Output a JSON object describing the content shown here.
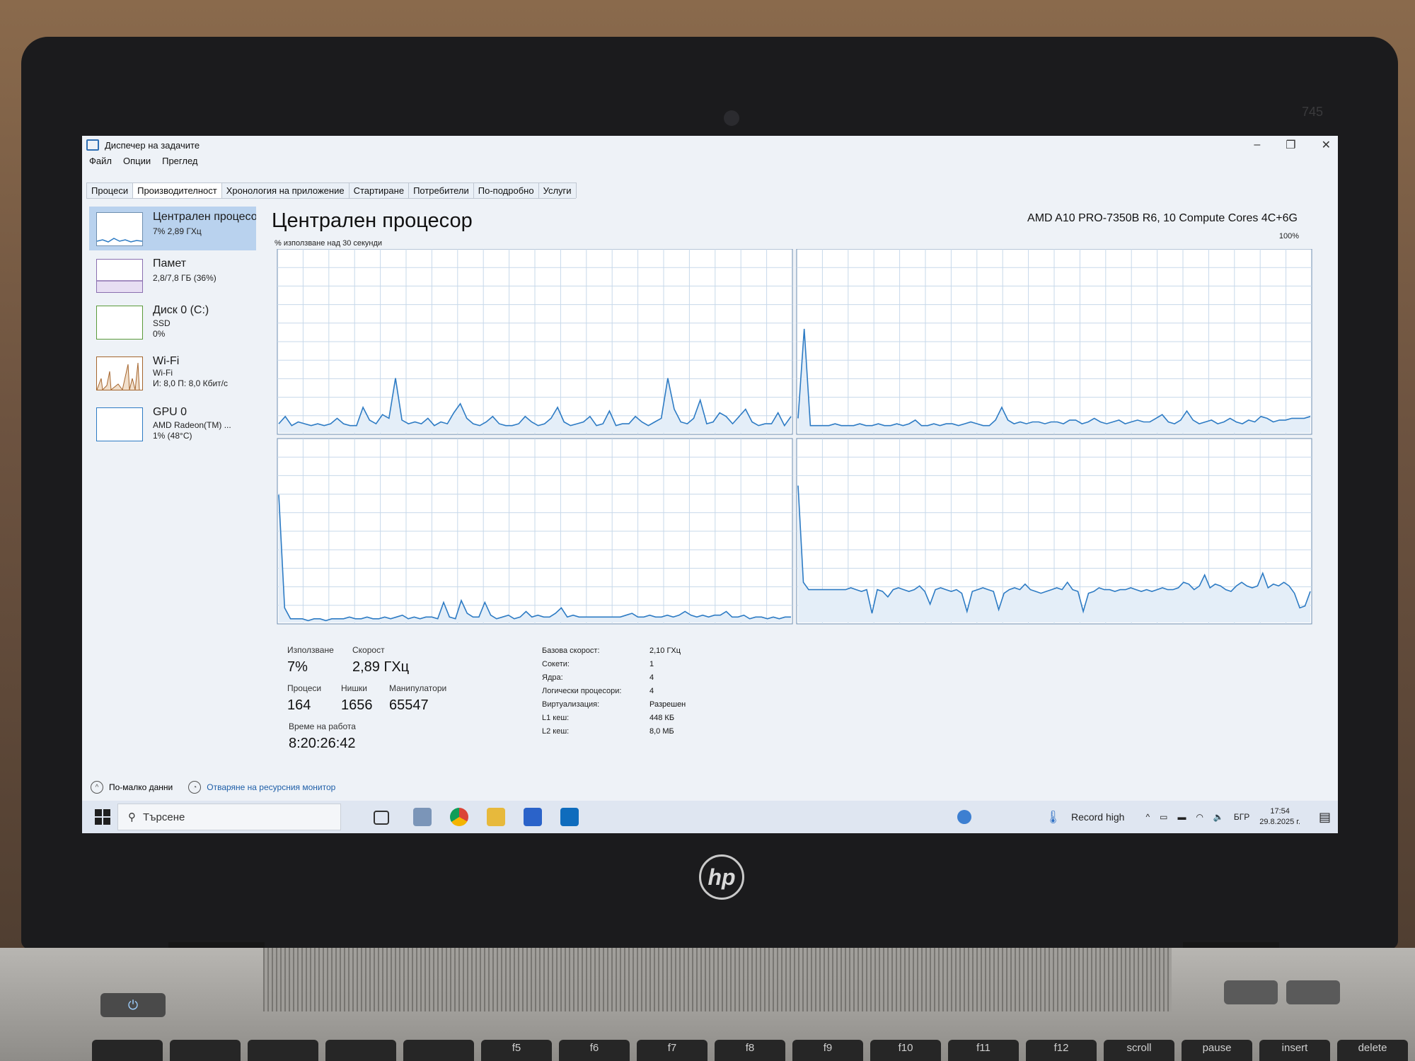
{
  "window": {
    "title": "Диспечер на задачите",
    "controls": [
      "–",
      "❐",
      "✕"
    ]
  },
  "menu": [
    "Файл",
    "Опции",
    "Преглед"
  ],
  "tabs": [
    {
      "label": "Процеси",
      "active": false
    },
    {
      "label": "Производителност",
      "active": true
    },
    {
      "label": "Хронология на приложение",
      "active": false
    },
    {
      "label": "Стартиране",
      "active": false
    },
    {
      "label": "Потребители",
      "active": false
    },
    {
      "label": "По-подробно",
      "active": false
    },
    {
      "label": "Услуги",
      "active": false
    }
  ],
  "sidebar": {
    "items": [
      {
        "name": "Централен процесор",
        "sub1": "7% 2,89 ГХц",
        "sub2": "",
        "sub3": ""
      },
      {
        "name": "Памет",
        "sub1": "2,8/7,8 ГБ (36%)",
        "sub2": "",
        "sub3": ""
      },
      {
        "name": "Диск 0 (C:)",
        "sub1": "SSD",
        "sub2": "0%",
        "sub3": ""
      },
      {
        "name": "Wi-Fi",
        "sub1": "Wi-Fi",
        "sub2": "И: 8,0  П: 8,0 Кбит/с",
        "sub3": ""
      },
      {
        "name": "GPU 0",
        "sub1": "AMD Radeon(TM) ...",
        "sub2": "1% (48°C)",
        "sub3": ""
      }
    ]
  },
  "main": {
    "title": "Централен процесор",
    "model": "AMD A10 PRO-7350B R6, 10 Compute Cores 4C+6G",
    "util_label": "% използване над 30 секунди",
    "max_label": "100%"
  },
  "chart_data": {
    "type": "line",
    "ylim": [
      0,
      100
    ],
    "grid": true,
    "panels": [
      {
        "values": [
          5,
          9,
          4,
          6,
          5,
          4,
          5,
          4,
          5,
          8,
          5,
          4,
          4,
          14,
          7,
          5,
          10,
          8,
          30,
          7,
          5,
          6,
          5,
          8,
          4,
          6,
          5,
          11,
          16,
          8,
          5,
          4,
          6,
          9,
          5,
          4,
          4,
          5,
          9,
          6,
          4,
          5,
          8,
          14,
          6,
          4,
          5,
          6,
          9,
          4,
          5,
          12,
          4,
          5,
          5,
          9,
          6,
          4,
          6,
          8,
          30,
          13,
          6,
          5,
          8,
          18,
          5,
          6,
          11,
          9,
          5,
          9,
          13,
          6,
          4,
          5,
          5,
          11,
          4,
          9
        ]
      },
      {
        "values": [
          8,
          57,
          4,
          4,
          4,
          4,
          5,
          4,
          4,
          4,
          5,
          4,
          4,
          5,
          4,
          4,
          5,
          4,
          5,
          7,
          4,
          4,
          5,
          4,
          5,
          5,
          4,
          5,
          6,
          5,
          4,
          4,
          7,
          14,
          7,
          5,
          6,
          5,
          6,
          6,
          5,
          6,
          6,
          5,
          7,
          7,
          5,
          6,
          8,
          6,
          5,
          6,
          7,
          5,
          6,
          7,
          6,
          6,
          8,
          10,
          6,
          5,
          7,
          12,
          7,
          5,
          6,
          7,
          5,
          6,
          8,
          6,
          5,
          7,
          6,
          9,
          8,
          6,
          7,
          7,
          8,
          8,
          8,
          9
        ]
      },
      {
        "values": [
          70,
          8,
          2,
          2,
          2,
          1,
          2,
          2,
          1,
          2,
          2,
          2,
          3,
          2,
          2,
          3,
          2,
          2,
          3,
          2,
          3,
          4,
          2,
          3,
          2,
          3,
          3,
          2,
          11,
          3,
          2,
          12,
          5,
          3,
          3,
          11,
          4,
          2,
          3,
          4,
          2,
          3,
          6,
          3,
          4,
          3,
          3,
          5,
          8,
          3,
          4,
          3,
          3,
          3,
          3,
          3,
          3,
          3,
          3,
          4,
          5,
          3,
          3,
          4,
          3,
          3,
          4,
          3,
          4,
          6,
          4,
          3,
          4,
          3,
          4,
          4,
          6,
          3,
          3,
          4,
          2,
          3,
          3,
          2,
          3,
          2,
          3,
          3
        ]
      },
      {
        "values": [
          75,
          22,
          18,
          18,
          18,
          18,
          18,
          18,
          18,
          18,
          19,
          18,
          17,
          18,
          5,
          18,
          17,
          14,
          18,
          19,
          18,
          17,
          18,
          20,
          17,
          10,
          18,
          19,
          18,
          17,
          18,
          16,
          6,
          17,
          18,
          19,
          18,
          17,
          7,
          16,
          18,
          19,
          18,
          21,
          18,
          17,
          16,
          17,
          18,
          19,
          18,
          22,
          18,
          17,
          6,
          16,
          17,
          19,
          18,
          18,
          17,
          18,
          18,
          19,
          18,
          17,
          18,
          17,
          18,
          19,
          18,
          18,
          19,
          22,
          21,
          18,
          20,
          26,
          19,
          21,
          20,
          18,
          17,
          20,
          22,
          20,
          19,
          20,
          27,
          19,
          21,
          20,
          22,
          20,
          16,
          8,
          9,
          17
        ]
      }
    ]
  },
  "stats": {
    "util_label": "Използване",
    "util_value": "7%",
    "speed_label": "Скорост",
    "speed_value": "2,89 ГХц",
    "proc_label": "Процеси",
    "proc_value": "164",
    "threads_label": "Нишки",
    "threads_value": "1656",
    "handles_label": "Манипулатори",
    "handles_value": "65547",
    "uptime_label": "Време на работа",
    "uptime_value": "8:20:26:42",
    "details": [
      {
        "k": "Базова скорост:",
        "v": "2,10 ГХц"
      },
      {
        "k": "Сокети:",
        "v": "1"
      },
      {
        "k": "Ядра:",
        "v": "4"
      },
      {
        "k": "Логически процесори:",
        "v": "4"
      },
      {
        "k": "Виртуализация:",
        "v": "Разрешен"
      },
      {
        "k": "L1 кеш:",
        "v": "448 КБ"
      },
      {
        "k": "L2 кеш:",
        "v": "8,0 МБ"
      }
    ]
  },
  "footer": {
    "less": "По-малко данни",
    "resmon": "Отваряне на ресурсния монитор"
  },
  "taskbar": {
    "search_placeholder": "Търсене",
    "weather": "Record high",
    "lang": "БГР",
    "time": "17:54",
    "date": "29.8.2025 г."
  },
  "laptop": {
    "model": "745",
    "keys": [
      "",
      "",
      "",
      "",
      "",
      "f5",
      "f6",
      "f7",
      "f8",
      "f9",
      "f10",
      "f11",
      "f12",
      "scroll",
      "pause",
      "insert",
      "delete"
    ]
  },
  "colors": {
    "graph_line": "#2d7bc4",
    "graph_fill": "#e4eef8",
    "grid": "#c7d8ea",
    "border": "#6f8fb0"
  }
}
